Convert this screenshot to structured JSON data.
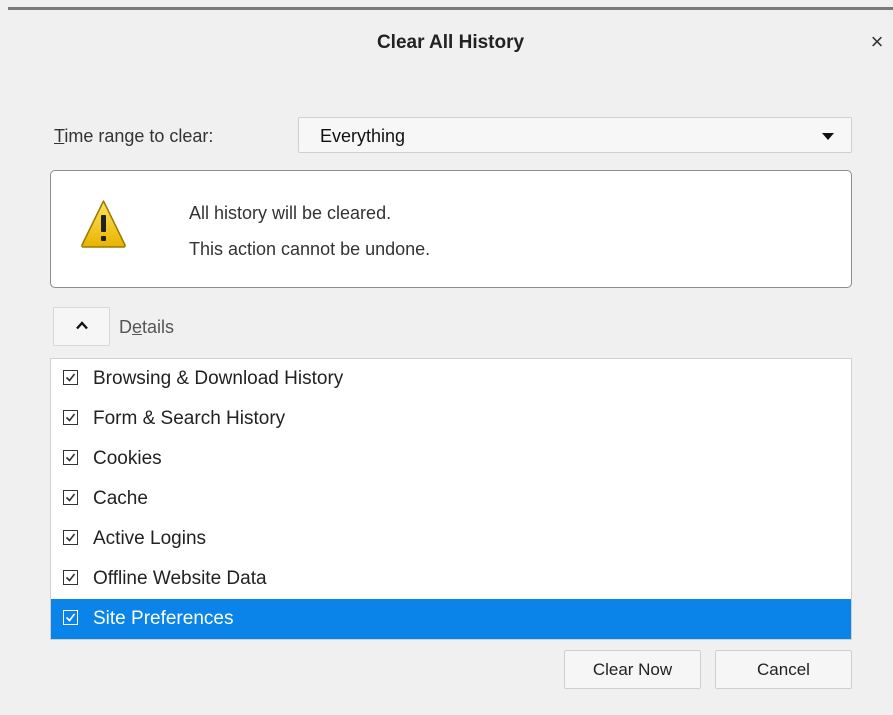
{
  "dialog": {
    "title": "Clear All History",
    "close_glyph": "×"
  },
  "time_range": {
    "label_access_key": "T",
    "label_rest": "ime range to clear:",
    "selected": "Everything"
  },
  "warning": {
    "icon": "warning-triangle-icon",
    "line1": "All history will be cleared.",
    "line2": "This action cannot be undone."
  },
  "details": {
    "toggle_icon": "chevron-up-icon",
    "label_pre": "D",
    "label_access_key": "e",
    "label_post": "tails"
  },
  "items": [
    {
      "label": "Browsing & Download History",
      "checked": true,
      "selected": false
    },
    {
      "label": "Form & Search History",
      "checked": true,
      "selected": false
    },
    {
      "label": "Cookies",
      "checked": true,
      "selected": false
    },
    {
      "label": "Cache",
      "checked": true,
      "selected": false
    },
    {
      "label": "Active Logins",
      "checked": true,
      "selected": false
    },
    {
      "label": "Offline Website Data",
      "checked": true,
      "selected": false
    },
    {
      "label": "Site Preferences",
      "checked": true,
      "selected": true
    }
  ],
  "buttons": {
    "clear_now": "Clear Now",
    "cancel": "Cancel"
  },
  "colors": {
    "selection": "#0a84e8",
    "warning_yellow": "#f5c400"
  }
}
